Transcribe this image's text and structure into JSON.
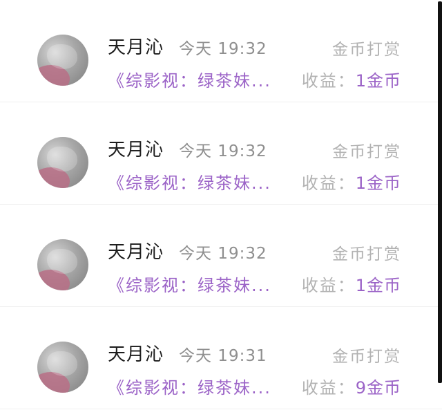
{
  "records": [
    {
      "user_name": "天月沁",
      "time": "今天 19:32",
      "reward_type": "金币打赏",
      "book_title": "《综影视：绿茶妹...",
      "earnings_label": "收益：",
      "earnings_value": "1金币"
    },
    {
      "user_name": "天月沁",
      "time": "今天 19:32",
      "reward_type": "金币打赏",
      "book_title": "《综影视：绿茶妹...",
      "earnings_label": "收益：",
      "earnings_value": "1金币"
    },
    {
      "user_name": "天月沁",
      "time": "今天 19:32",
      "reward_type": "金币打赏",
      "book_title": "《综影视：绿茶妹...",
      "earnings_label": "收益：",
      "earnings_value": "1金币"
    },
    {
      "user_name": "天月沁",
      "time": "今天 19:31",
      "reward_type": "金币打赏",
      "book_title": "《综影视：绿茶妹...",
      "earnings_label": "收益：",
      "earnings_value": "9金币"
    }
  ],
  "colors": {
    "accent": "#9b63c7",
    "muted": "#b2b2b2",
    "name": "#1d1d1d"
  }
}
